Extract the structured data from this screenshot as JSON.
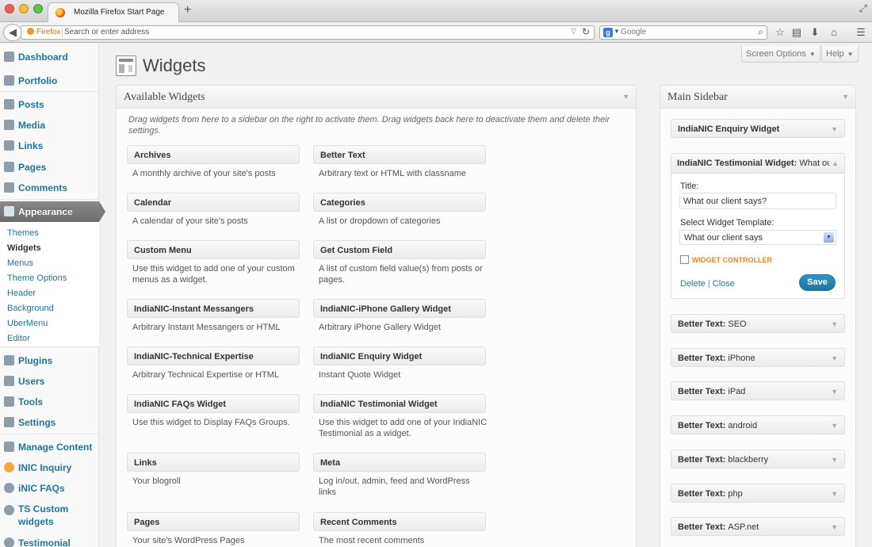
{
  "browser": {
    "tab_title": "Mozilla Firefox Start Page",
    "new_tab": "+",
    "identity": "Firefox",
    "url_placeholder": "Search or enter address",
    "search_engine": "g",
    "search_placeholder": "Google"
  },
  "admin_menu": {
    "items": [
      {
        "label": "Dashboard"
      },
      {
        "label": "Portfolio"
      },
      {
        "label": "Posts"
      },
      {
        "label": "Media"
      },
      {
        "label": "Links"
      },
      {
        "label": "Pages"
      },
      {
        "label": "Comments"
      },
      {
        "label": "Appearance"
      },
      {
        "label": "Plugins"
      },
      {
        "label": "Users"
      },
      {
        "label": "Tools"
      },
      {
        "label": "Settings"
      },
      {
        "label": "Manage Content"
      },
      {
        "label": "INIC Inquiry"
      },
      {
        "label": "iNIC FAQs"
      },
      {
        "label": "TS Custom widgets"
      },
      {
        "label": "Testimonial"
      }
    ],
    "submenu": [
      "Themes",
      "Widgets",
      "Menus",
      "Theme Options",
      "Header",
      "Background",
      "UberMenu",
      "Editor"
    ],
    "current_sub": "Widgets"
  },
  "header": {
    "title": "Widgets",
    "screen_options": "Screen Options",
    "help": "Help"
  },
  "available": {
    "title": "Available Widgets",
    "intro": "Drag widgets from here to a sidebar on the right to activate them. Drag widgets back here to deactivate them and delete their settings.",
    "widgets": [
      {
        "title": "Archives",
        "desc": "A monthly archive of your site's posts"
      },
      {
        "title": "Better Text",
        "desc": "Arbitrary text or HTML with classname"
      },
      {
        "title": "Calendar",
        "desc": "A calendar of your site's posts"
      },
      {
        "title": "Categories",
        "desc": "A list or dropdown of categories"
      },
      {
        "title": "Custom Menu",
        "desc": "Use this widget to add one of your custom menus as a widget."
      },
      {
        "title": "Get Custom Field",
        "desc": "A list of custom field value(s) from posts or pages."
      },
      {
        "title": "IndiaNIC-Instant Messangers",
        "desc": "Arbitrary Instant Messangers or HTML"
      },
      {
        "title": "IndiaNIC-iPhone Gallery Widget",
        "desc": "Arbitrary iPhone Gallery Widget"
      },
      {
        "title": "IndiaNIC-Technical Expertise",
        "desc": "Arbitrary Technical Expertise or HTML"
      },
      {
        "title": "IndiaNIC Enquiry Widget",
        "desc": "Instant Quote Widget"
      },
      {
        "title": "IndiaNIC FAQs Widget",
        "desc": "Use this widget to Display FAQs Groups."
      },
      {
        "title": "IndiaNIC Testimonial Widget",
        "desc": "Use this widget to add one of your IndiaNIC Testimonial as a widget."
      },
      {
        "title": "Links",
        "desc": "Your blogroll"
      },
      {
        "title": "Meta",
        "desc": "Log in/out, admin, feed and WordPress links"
      },
      {
        "title": "Pages",
        "desc": "Your site's WordPress Pages"
      },
      {
        "title": "Recent Comments",
        "desc": "The most recent comments"
      }
    ]
  },
  "main_sidebar": {
    "title": "Main Sidebar",
    "enquiry_widget": "IndiaNIC Enquiry Widget",
    "open_widget": {
      "title": "IndiaNIC Testimonial Widget:",
      "title_suffix": "What our",
      "title_label": "Title:",
      "title_value": "What our client says?",
      "template_label": "Select Widget Template:",
      "template_value": "What our client says",
      "controller_label": "WIDGET CONTROLLER",
      "delete": "Delete",
      "separator": "|",
      "close": "Close",
      "save": "Save"
    },
    "widgets": [
      {
        "name": "Better Text:",
        "suffix": "SEO"
      },
      {
        "name": "Better Text:",
        "suffix": "iPhone"
      },
      {
        "name": "Better Text:",
        "suffix": "iPad"
      },
      {
        "name": "Better Text:",
        "suffix": "android"
      },
      {
        "name": "Better Text:",
        "suffix": "blackberry"
      },
      {
        "name": "Better Text:",
        "suffix": "php"
      },
      {
        "name": "Better Text:",
        "suffix": "ASP.net"
      }
    ]
  },
  "colors": {
    "link": "#21759b",
    "active_menu": "#7b7b7b",
    "controller": "#e1882b"
  }
}
